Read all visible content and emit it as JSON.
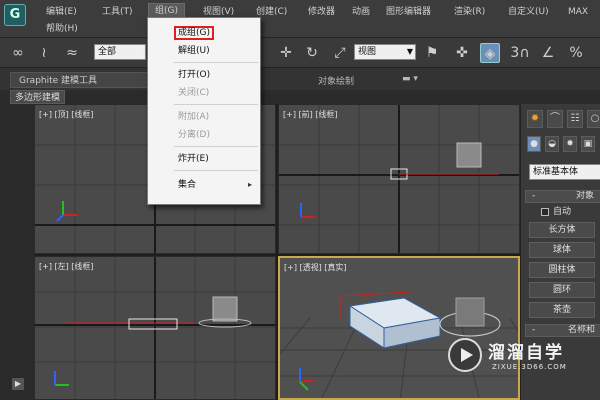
{
  "app": {
    "logo_glyph": "G"
  },
  "menubar": {
    "items": [
      "编辑(E)",
      "工具(T)",
      "组(G)",
      "视图(V)",
      "创建(C)",
      "修改器",
      "动画",
      "图形编辑器",
      "渲染(R)",
      "自定义(U)",
      "MAX"
    ],
    "help": "帮助(H)",
    "active_index": 2
  },
  "toolbar": {
    "selection_filter": "全部",
    "view_ref": "视图",
    "snap_label": "3",
    "percent_label": "%"
  },
  "ribbon": {
    "tab_graphite": "Graphite 建模工具",
    "label_paint": "对象绘制",
    "subtab": "多边形建模"
  },
  "viewports": {
    "top_left": "[+] [顶] [线框]",
    "top_right": "[+] [前] [线框]",
    "bottom_left": "[+] [左] [线框]",
    "bottom_right": "[+] [透视] [真实]"
  },
  "group_menu": {
    "items": [
      {
        "label": "成组(G)",
        "disabled": false,
        "highlighted": true
      },
      {
        "label": "解组(U)",
        "disabled": false
      },
      {
        "label": "打开(O)",
        "disabled": false
      },
      {
        "label": "关闭(C)",
        "disabled": true
      },
      {
        "label": "附加(A)",
        "disabled": true
      },
      {
        "label": "分离(D)",
        "disabled": true
      },
      {
        "label": "炸开(E)",
        "disabled": false
      },
      {
        "label": "集合",
        "disabled": false,
        "submenu": true
      }
    ],
    "submenu_glyph": "▸"
  },
  "command_panel": {
    "category": "标准基本体",
    "rollout_object_type": "对象",
    "autogrid": "自动",
    "buttons": [
      "长方体",
      "球体",
      "圆柱体",
      "圆环",
      "茶壶"
    ],
    "rollout_name_color": "名称和"
  },
  "watermark": {
    "title": "溜溜自学",
    "url": "ZIXUE.3D66.COM"
  },
  "colors": {
    "accent_active_viewport": "#c8a94c",
    "highlight_box": "#e02020",
    "axis_x": "#d02020",
    "axis_y": "#20c020",
    "axis_z": "#3060ff"
  }
}
